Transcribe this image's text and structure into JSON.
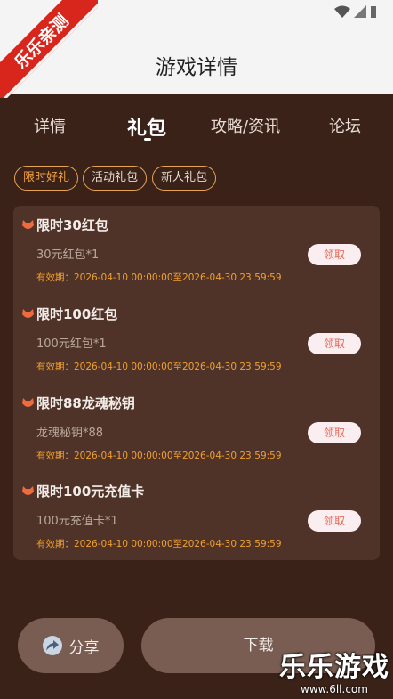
{
  "header": {
    "title": "游戏详情",
    "ribbon": "乐乐亲测"
  },
  "tabs": [
    {
      "label": "详情"
    },
    {
      "label": "礼包"
    },
    {
      "label": "攻略/资讯"
    },
    {
      "label": "论坛"
    }
  ],
  "chips": [
    {
      "label": "限时好礼"
    },
    {
      "label": "活动礼包"
    },
    {
      "label": "新人礼包"
    }
  ],
  "gifts": [
    {
      "name": "限时30红包",
      "desc": "30元红包*1",
      "valid": "有效期：2026-04-10 00:00:00至2026-04-30 23:59:59",
      "claim": "领取"
    },
    {
      "name": "限时100红包",
      "desc": "100元红包*1",
      "valid": "有效期：2026-04-10 00:00:00至2026-04-30 23:59:59",
      "claim": "领取"
    },
    {
      "name": "限时88龙魂秘钥",
      "desc": "龙魂秘钥*88",
      "valid": "有效期：2026-04-10 00:00:00至2026-04-30 23:59:59",
      "claim": "领取"
    },
    {
      "name": "限时100元充值卡",
      "desc": "100元充值卡*1",
      "valid": "有效期：2026-04-10 00:00:00至2026-04-30 23:59:59",
      "claim": "领取"
    }
  ],
  "bottom": {
    "share": "分享",
    "download": "下载"
  },
  "watermark": {
    "main": "乐乐游戏",
    "sub": "www.6ll.com"
  },
  "colors": {
    "accent": "#f0a030",
    "background": "#3a2218",
    "card": "#503328",
    "claim_text": "#e46a5a"
  },
  "icons": {
    "back": "back-arrow-icon",
    "wifi": "wifi-icon",
    "signal": "signal-icon",
    "gift": "gift-icon",
    "share": "share-icon"
  }
}
